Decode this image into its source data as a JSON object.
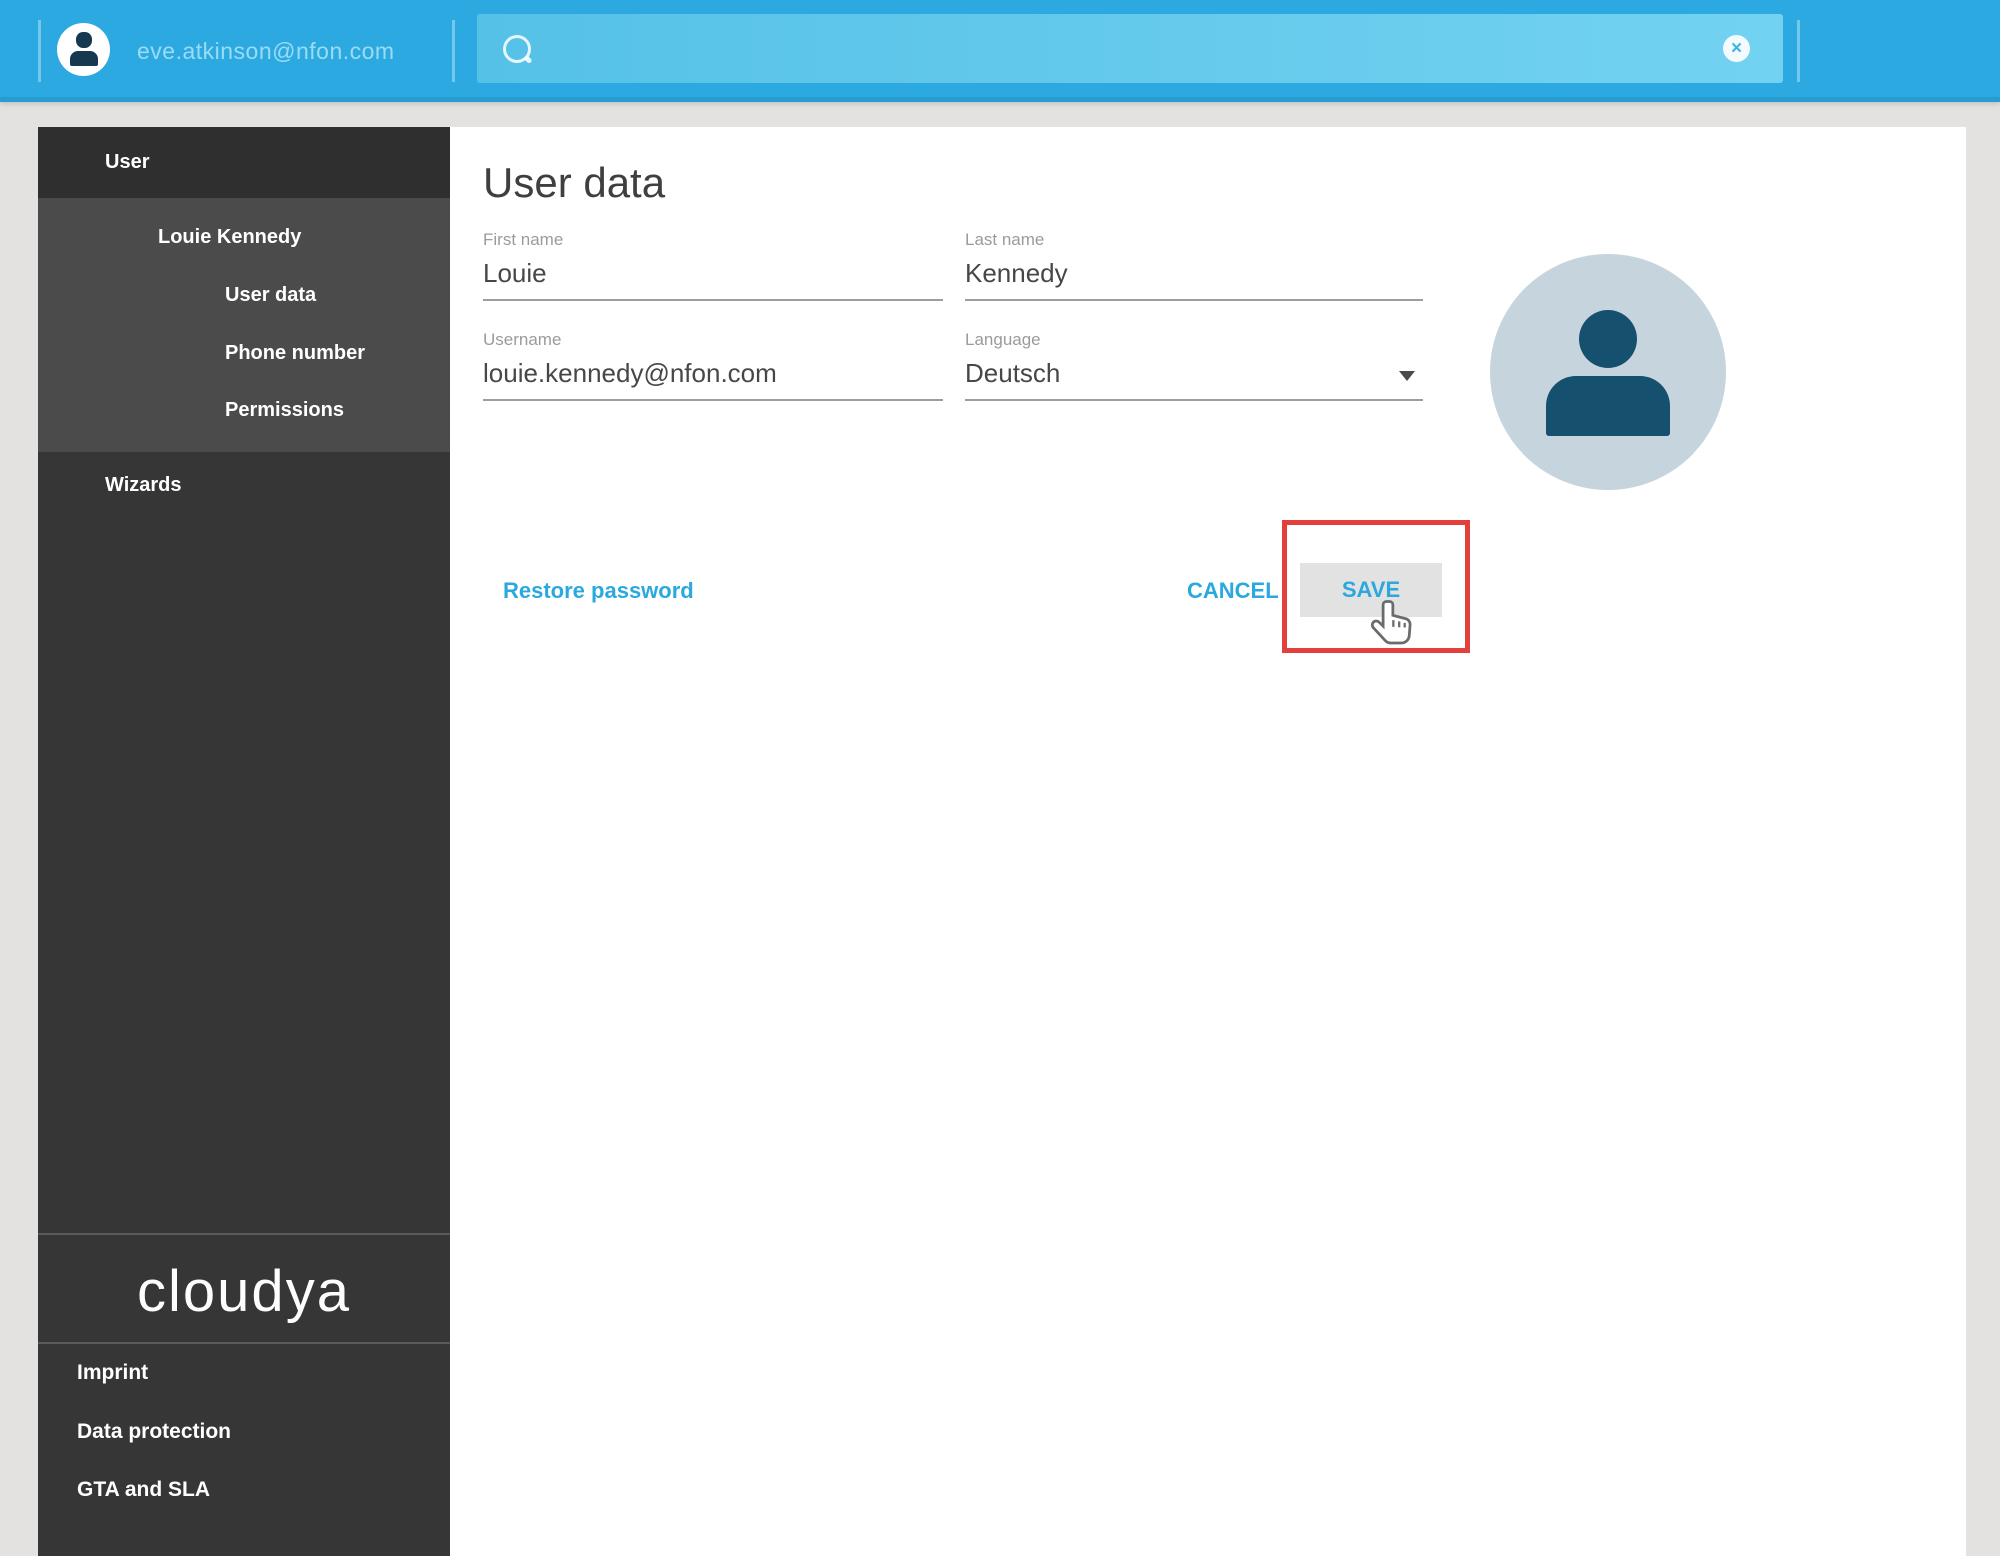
{
  "topbar": {
    "email": "eve.atkinson@nfon.com",
    "search": {
      "value": "",
      "placeholder": ""
    },
    "clear_label": "×"
  },
  "sidebar": {
    "items": [
      {
        "label": "User"
      },
      {
        "label": "Louie Kennedy"
      },
      {
        "label": "User data"
      },
      {
        "label": "Phone number"
      },
      {
        "label": "Permissions"
      },
      {
        "label": "Wizards"
      }
    ],
    "logo": "cloudya",
    "footer_links": [
      {
        "label": "Imprint"
      },
      {
        "label": "Data protection"
      },
      {
        "label": "GTA and SLA"
      }
    ]
  },
  "content": {
    "title": "User data",
    "fields": [
      {
        "label": "First name",
        "value": "Louie"
      },
      {
        "label": "Last name",
        "value": "Kennedy"
      },
      {
        "label": "Username",
        "value": "louie.kennedy@nfon.com"
      },
      {
        "label": "Language",
        "value": "Deutsch"
      }
    ],
    "restore_link": "Restore password",
    "buttons": {
      "cancel": "CANCEL",
      "save": "SAVE"
    }
  },
  "colors": {
    "topbar": "#2BA9E0",
    "search_bg": "#5EC7EB",
    "accent_link": "#2BA9DF",
    "sidebar_bg": "#363636",
    "sidebar_active_group_bg": "#4B4B4B",
    "highlight_red": "#E2403C",
    "avatar_bg": "#C6D5DD",
    "avatar_glyph": "#15506E",
    "content_bg": "#FFFFFF",
    "frame_bg": "#E3E2E1"
  }
}
